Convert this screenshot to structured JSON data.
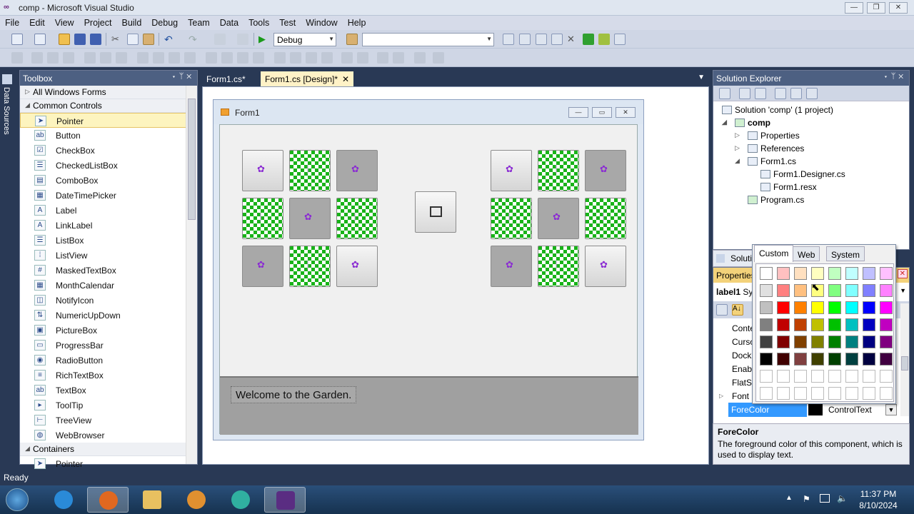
{
  "window": {
    "title": "comp - Microsoft Visual Studio"
  },
  "menu": [
    "File",
    "Edit",
    "View",
    "Project",
    "Build",
    "Debug",
    "Team",
    "Data",
    "Tools",
    "Test",
    "Window",
    "Help"
  ],
  "toolbar": {
    "config": "Debug",
    "platform": ""
  },
  "datasources": {
    "label": "Data Sources"
  },
  "toolbox": {
    "title": "Toolbox",
    "cat_all": "All Windows Forms",
    "cat_common": "Common Controls",
    "items": [
      {
        "label": "Pointer",
        "icon": "pointer-icon"
      },
      {
        "label": "Button",
        "icon": "button-icon"
      },
      {
        "label": "CheckBox",
        "icon": "checkbox-icon"
      },
      {
        "label": "CheckedListBox",
        "icon": "checkedlistbox-icon"
      },
      {
        "label": "ComboBox",
        "icon": "combobox-icon"
      },
      {
        "label": "DateTimePicker",
        "icon": "datetimepicker-icon"
      },
      {
        "label": "Label",
        "icon": "label-icon"
      },
      {
        "label": "LinkLabel",
        "icon": "linklabel-icon"
      },
      {
        "label": "ListBox",
        "icon": "listbox-icon"
      },
      {
        "label": "ListView",
        "icon": "listview-icon"
      },
      {
        "label": "MaskedTextBox",
        "icon": "maskedtextbox-icon"
      },
      {
        "label": "MonthCalendar",
        "icon": "monthcalendar-icon"
      },
      {
        "label": "NotifyIcon",
        "icon": "notifyicon-icon"
      },
      {
        "label": "NumericUpDown",
        "icon": "numericupdown-icon"
      },
      {
        "label": "PictureBox",
        "icon": "picturebox-icon"
      },
      {
        "label": "ProgressBar",
        "icon": "progressbar-icon"
      },
      {
        "label": "RadioButton",
        "icon": "radiobutton-icon"
      },
      {
        "label": "RichTextBox",
        "icon": "richtextbox-icon"
      },
      {
        "label": "TextBox",
        "icon": "textbox-icon"
      },
      {
        "label": "ToolTip",
        "icon": "tooltip-icon"
      },
      {
        "label": "TreeView",
        "icon": "treeview-icon"
      },
      {
        "label": "WebBrowser",
        "icon": "webbrowser-icon"
      }
    ],
    "cat_containers": "Containers",
    "containers_first": "Pointer"
  },
  "tabs": {
    "code": "Form1.cs*",
    "design": "Form1.cs [Design]*"
  },
  "form": {
    "title": "Form1",
    "welcome": "Welcome to the Garden."
  },
  "solution": {
    "title": "Solution Explorer",
    "solution": "Solution 'comp' (1 project)",
    "project": "comp",
    "properties": "Properties",
    "references": "References",
    "form1": "Form1.cs",
    "designer": "Form1.Designer.cs",
    "resx": "Form1.resx",
    "program": "Program.cs"
  },
  "properties": {
    "title": "Properties",
    "tab_solution": "Soluti",
    "object": "label1",
    "object_type": "Sy",
    "rows": [
      "Conte",
      "Curso",
      "Dock",
      "Enabl",
      "FlatSt",
      "Font"
    ],
    "forecolor_name": "ForeColor",
    "forecolor_value": "ControlText",
    "desc_title": "ForeColor",
    "desc_text": "The foreground color of this component, which is used to display text."
  },
  "colorpicker": {
    "tabs": [
      "Custom",
      "Web",
      "System"
    ],
    "swatches": [
      [
        "#ffffff",
        "#ffc0c0",
        "#ffe0c0",
        "#ffffc0",
        "#c0ffc0",
        "#c0ffff",
        "#c0c0ff",
        "#ffc0ff"
      ],
      [
        "#e0e0e0",
        "#ff8080",
        "#ffc080",
        "#ffff80",
        "#80ff80",
        "#80ffff",
        "#8080ff",
        "#ff80ff"
      ],
      [
        "#c0c0c0",
        "#ff0000",
        "#ff8000",
        "#ffff00",
        "#00ff00",
        "#00ffff",
        "#0000ff",
        "#ff00ff"
      ],
      [
        "#808080",
        "#c00000",
        "#c04000",
        "#c0c000",
        "#00c000",
        "#00c0c0",
        "#0000c0",
        "#c000c0"
      ],
      [
        "#404040",
        "#800000",
        "#804000",
        "#808000",
        "#008000",
        "#008080",
        "#000080",
        "#800080"
      ],
      [
        "#000000",
        "#400000",
        "#804040",
        "#404000",
        "#004000",
        "#004040",
        "#000040",
        "#400040"
      ],
      [
        "#ffffff",
        "#ffffff",
        "#ffffff",
        "#ffffff",
        "#ffffff",
        "#ffffff",
        "#ffffff",
        "#ffffff"
      ],
      [
        "#ffffff",
        "#ffffff",
        "#ffffff",
        "#ffffff",
        "#ffffff",
        "#ffffff",
        "#ffffff",
        "#ffffff"
      ]
    ]
  },
  "status": "Ready",
  "clock": {
    "time": "11:37 PM",
    "date": "8/10/2024"
  }
}
